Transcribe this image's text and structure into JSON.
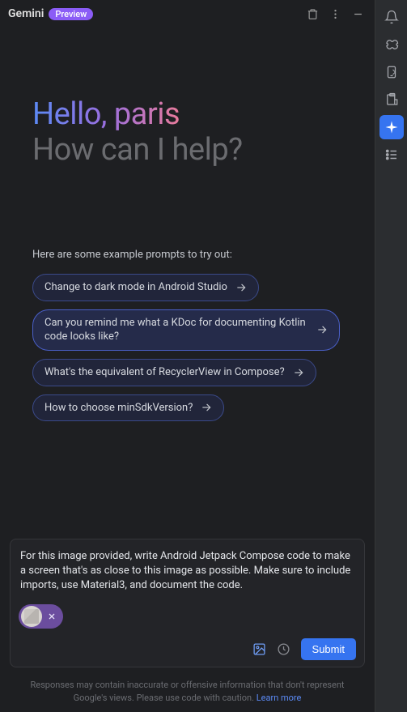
{
  "header": {
    "title": "Gemini",
    "preview_badge": "Preview"
  },
  "greeting": {
    "hello": "Hello, paris",
    "help": "How can I help?"
  },
  "prompts": {
    "label": "Here are some example prompts to try out:",
    "chips": [
      "Change to dark mode in Android Studio",
      "Can you remind me what a KDoc for documenting Kotlin code looks like?",
      "What's the equivalent of RecyclerView in Compose?",
      "How to choose minSdkVersion?"
    ]
  },
  "input": {
    "text": "For this image provided, write Android Jetpack Compose code to make a screen that's as close to this image as possible. Make sure to include imports, use Material3, and document the code.",
    "submit_label": "Submit"
  },
  "disclaimer": {
    "text": "Responses may contain inaccurate or offensive information that don't represent Google's views. Please use code with caution.",
    "learn_more": "Learn more"
  }
}
